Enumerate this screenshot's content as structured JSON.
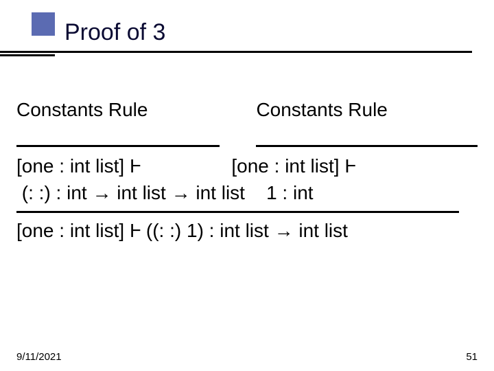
{
  "title": "Proof of 3",
  "rule_label_left": "Constants Rule",
  "rule_label_right": "Constants Rule",
  "premise_left_line1": "[one : int list] Ⱶ",
  "premise_left_line2": " (: :) : int → int list → int list",
  "premise_right_line1": "[one : int list] Ⱶ",
  "premise_right_line2_tail": "1 : int",
  "conclusion": "[one : int list] Ⱶ ((: :) 1) : int list → int list",
  "footer_date": "9/11/2021",
  "footer_page": "51"
}
